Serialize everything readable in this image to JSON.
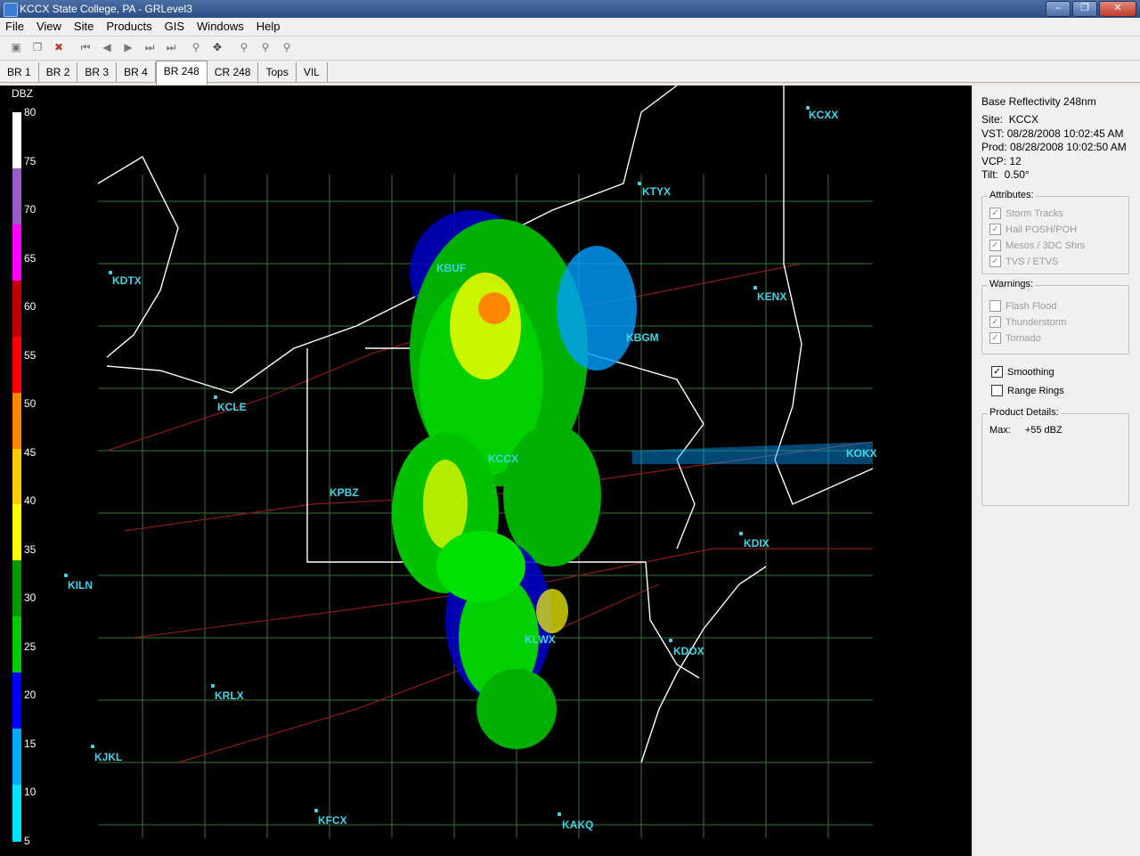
{
  "window": {
    "title": "KCCX State College, PA - GRLevel3"
  },
  "menu": [
    "File",
    "View",
    "Site",
    "Products",
    "GIS",
    "Windows",
    "Help"
  ],
  "tabs": [
    "BR 1",
    "BR 2",
    "BR 3",
    "BR 4",
    "BR 248",
    "CR 248",
    "Tops",
    "VIL"
  ],
  "active_tab": "BR 248",
  "legend": {
    "title": "DBZ",
    "labels": [
      "80",
      "75",
      "70",
      "65",
      "60",
      "55",
      "50",
      "45",
      "40",
      "35",
      "30",
      "25",
      "20",
      "15",
      "10",
      "5"
    ],
    "colors": [
      "#ffffff",
      "#9b59c9",
      "#ff00ff",
      "#c00000",
      "#ff0000",
      "#ff8800",
      "#ffcc00",
      "#ffff00",
      "#009900",
      "#00cc00",
      "#0000ff",
      "#00aaff",
      "#00e5ff"
    ]
  },
  "sites": [
    "KCXX",
    "KTYX",
    "KENX",
    "KBUF",
    "KBGM",
    "KDTX",
    "KCLE",
    "KCCX",
    "KPBZ",
    "KOKX",
    "KDIX",
    "KILN",
    "KLWX",
    "KDOX",
    "KRLX",
    "KJKL",
    "KFCX",
    "KAKQ"
  ],
  "info": {
    "product": "Base Reflectivity 248nm",
    "site_label": "Site:",
    "site": "KCCX",
    "vst_label": "VST:",
    "vst": "08/28/2008  10:02:45 AM",
    "prod_label": "Prod:",
    "prod": "08/28/2008  10:02:50 AM",
    "vcp_label": "VCP:",
    "vcp": "12",
    "tilt_label": "Tilt:",
    "tilt": "0.50°"
  },
  "attributes": {
    "title": "Attributes:",
    "items": [
      "Storm Tracks",
      "Hail POSH/POH",
      "Mesos / 3DC Shrs",
      "TVS / ETVS"
    ]
  },
  "warnings": {
    "title": "Warnings:",
    "items": [
      "Flash Flood",
      "Thunderstorm",
      "Tornado"
    ]
  },
  "options": {
    "smoothing": "Smoothing",
    "range_rings": "Range Rings"
  },
  "details": {
    "title": "Product Details:",
    "max_label": "Max:",
    "max_value": "+55 dBZ"
  },
  "colors": {
    "site_label": "#3fd6e8",
    "background": "#000000",
    "county": "#2f7a2f",
    "state": "#ffffff",
    "highway": "#8b1a1a"
  }
}
